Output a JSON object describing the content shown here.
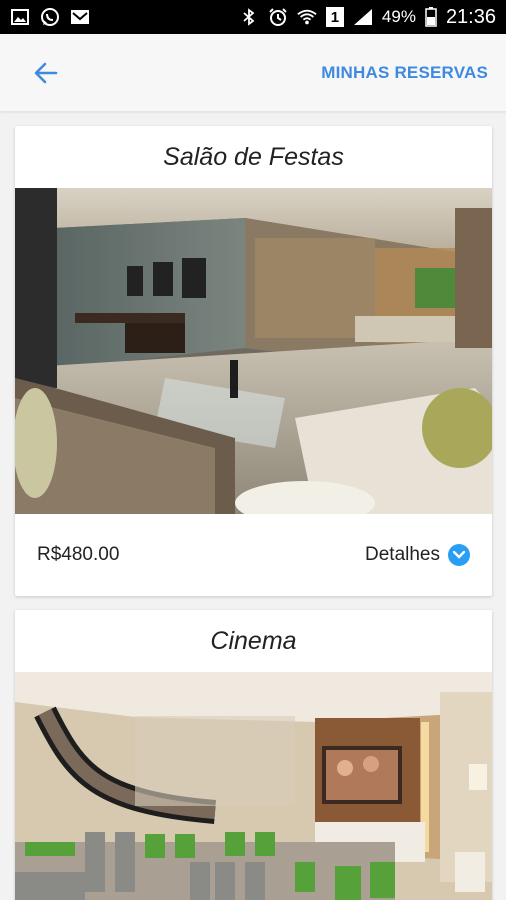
{
  "status_bar": {
    "battery": "49%",
    "time": "21:36",
    "sim_slot": "1"
  },
  "app_bar": {
    "action_label": "MINHAS RESERVAS",
    "back_icon": "arrow-left-icon"
  },
  "cards": [
    {
      "title": "Salão de Festas",
      "price": "R$480.00",
      "details_label": "Detalhes",
      "details_icon": "chevron-down-circle-icon"
    },
    {
      "title": "Cinema"
    }
  ],
  "colors": {
    "accent": "#3f8ae0",
    "details_badge": "#2a9df4"
  }
}
